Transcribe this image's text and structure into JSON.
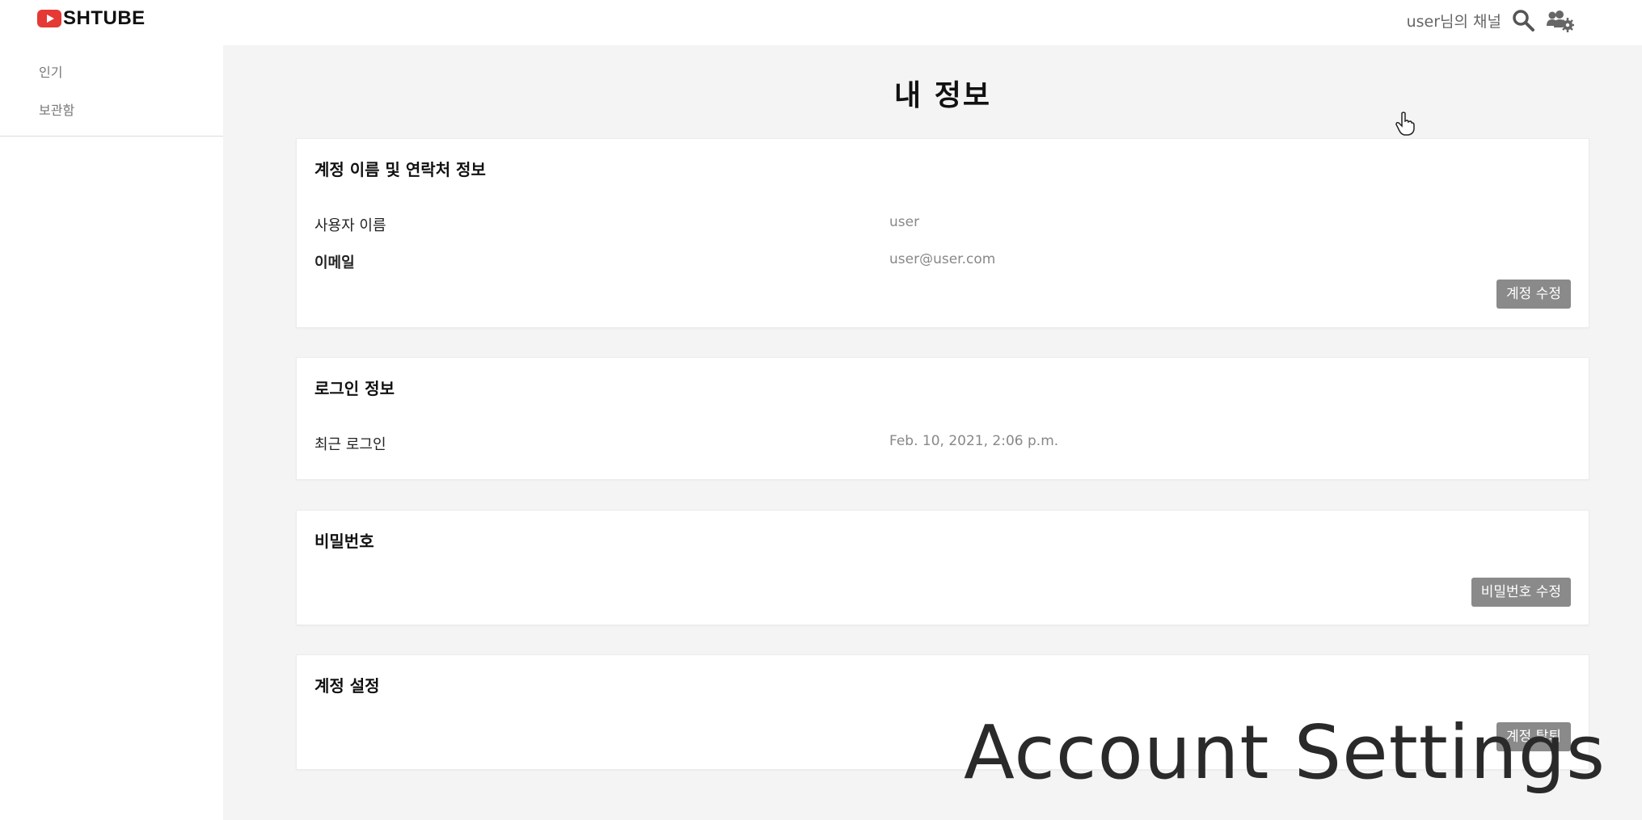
{
  "app": {
    "brand": "SHTUBE"
  },
  "header": {
    "channel_link": "user님의 채널",
    "search_icon": "search-icon",
    "settings_icon": "users-gear-icon"
  },
  "sidebar": {
    "items": [
      {
        "label": "인기"
      },
      {
        "label": "보관함"
      }
    ]
  },
  "main": {
    "title": "내 정보",
    "sections": {
      "account": {
        "title": "계정 이름 및 연락처 정보",
        "username_label": "사용자 이름",
        "username_value": "user",
        "email_label": "이메일",
        "email_value": "user@user.com",
        "edit_button": "계정 수정"
      },
      "login": {
        "title": "로그인 정보",
        "last_login_label": "최근 로그인",
        "last_login_value": "Feb. 10, 2021, 2:06 p.m."
      },
      "password": {
        "title": "비밀번호",
        "edit_button": "비밀번호 수정"
      },
      "settings": {
        "title": "계정 설정",
        "delete_button": "계정 탈퇴"
      }
    }
  },
  "overlay": {
    "caption": "Account Settings"
  },
  "colors": {
    "brand_red": "#e53935",
    "button_gray": "#8a8a8a",
    "page_bg": "#f4f4f4"
  }
}
